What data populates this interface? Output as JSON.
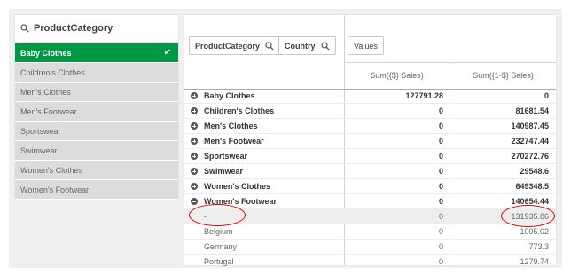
{
  "filter": {
    "title": "ProductCategory",
    "items": [
      {
        "label": "Baby Clothes",
        "selected": true
      },
      {
        "label": "Children's Clothes",
        "selected": false
      },
      {
        "label": "Men's Clothes",
        "selected": false
      },
      {
        "label": "Men's Footwear",
        "selected": false
      },
      {
        "label": "Sportswear",
        "selected": false
      },
      {
        "label": "Swimwear",
        "selected": false
      },
      {
        "label": "Women's Clothes",
        "selected": false
      },
      {
        "label": "Women's Footwear",
        "selected": false
      }
    ]
  },
  "table": {
    "dimensions": [
      "ProductCategory",
      "Country"
    ],
    "values_label": "Values",
    "columns": [
      "Sum({$} Sales)",
      "Sum({1-$} Sales)"
    ],
    "rows": [
      {
        "label": "Baby Clothes",
        "v1": "127791.28",
        "v2": "0",
        "type": "parent",
        "expanded": false
      },
      {
        "label": "Children's Clothes",
        "v1": "0",
        "v2": "81681.54",
        "type": "parent",
        "expanded": false
      },
      {
        "label": "Men's Clothes",
        "v1": "0",
        "v2": "140987.45",
        "type": "parent",
        "expanded": false
      },
      {
        "label": "Men's Footwear",
        "v1": "0",
        "v2": "232747.44",
        "type": "parent",
        "expanded": false
      },
      {
        "label": "Sportswear",
        "v1": "0",
        "v2": "270272.76",
        "type": "parent",
        "expanded": false
      },
      {
        "label": "Swimwear",
        "v1": "0",
        "v2": "29548.6",
        "type": "parent",
        "expanded": false
      },
      {
        "label": "Women's Clothes",
        "v1": "0",
        "v2": "649348.5",
        "type": "parent",
        "expanded": false
      },
      {
        "label": "Women's Footwear",
        "v1": "0",
        "v2": "140654.44",
        "type": "parent",
        "expanded": true
      },
      {
        "label": "-",
        "v1": "0",
        "v2": "131935.86",
        "type": "child"
      },
      {
        "label": "Belgium",
        "v1": "0",
        "v2": "1005.02",
        "type": "child"
      },
      {
        "label": "Germany",
        "v1": "0",
        "v2": "773.3",
        "type": "child"
      },
      {
        "label": "Portugal",
        "v1": "0",
        "v2": "1279.74",
        "type": "child"
      }
    ]
  },
  "colors": {
    "selected": "#009845",
    "annotation": "#e00000",
    "background": "#f0f0f0"
  }
}
